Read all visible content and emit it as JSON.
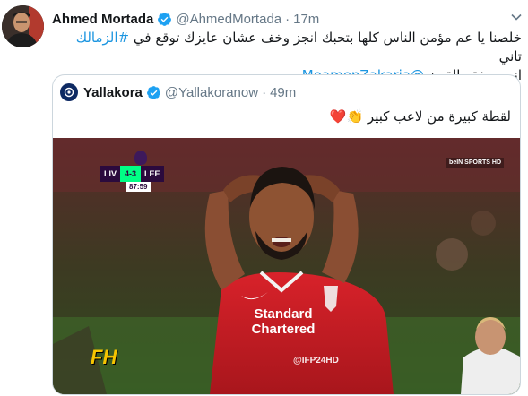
{
  "tweet": {
    "author_name": "Ahmed Mortada",
    "author_handle": "@AhmedMortada",
    "separator": "·",
    "time": "17m",
    "text_main": "خلصنا يا عم مؤمن الناس كلها بتحبك انجز وخف عشان عايزك توقع في ",
    "hashtag": "#الزمالك",
    "text_after_hashtag": " تاني",
    "text_line2": "انت صفقه القرن ",
    "mention": "@MoamenZakaria"
  },
  "quoted_tweet": {
    "author_name": "Yallakora",
    "author_handle": "@Yallakoranow",
    "separator": "·",
    "time": "49m",
    "text": "لقطة كبيرة من لاعب كبير 👏❤️"
  },
  "media": {
    "scoreboard": {
      "home": "LIV",
      "score": "4-3",
      "away": "LEE",
      "clock": "87:59"
    },
    "broadcaster": "beIN SPORTS HD",
    "sponsor": "Standard Chartered",
    "handle_overlay": "@IFP24HD",
    "logo": "FH"
  },
  "colors": {
    "link": "#1b95e0",
    "verified": "#1da1f2",
    "muted": "#657786",
    "border": "#ccd6dd"
  },
  "icons": {
    "verified": "verified-badge-icon",
    "caret": "chevron-down-icon"
  }
}
